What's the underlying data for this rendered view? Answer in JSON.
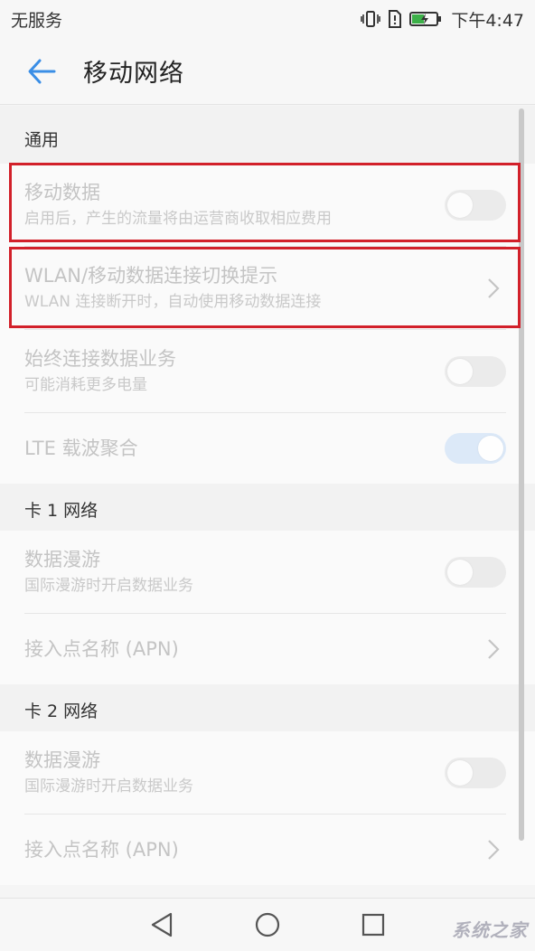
{
  "status_bar": {
    "carrier": "无服务",
    "time": "下午4:47",
    "battery_level": 0.5
  },
  "header": {
    "title": "移动网络"
  },
  "sections": {
    "general": {
      "label": "通用",
      "items": [
        {
          "title": "移动数据",
          "subtitle": "启用后，产生的流量将由运营商收取相应费用",
          "control": "toggle",
          "on": false
        },
        {
          "title": "WLAN/移动数据连接切换提示",
          "subtitle": "WLAN 连接断开时，自动使用移动数据连接",
          "control": "chevron"
        },
        {
          "title": "始终连接数据业务",
          "subtitle": "可能消耗更多电量",
          "control": "toggle",
          "on": false
        },
        {
          "title": "LTE 载波聚合",
          "control": "toggle",
          "on": true
        }
      ]
    },
    "sim1": {
      "label": "卡 1 网络",
      "items": [
        {
          "title": "数据漫游",
          "subtitle": "国际漫游时开启数据业务",
          "control": "toggle",
          "on": false
        },
        {
          "title": "接入点名称 (APN)",
          "control": "chevron"
        }
      ]
    },
    "sim2": {
      "label": "卡 2 网络",
      "items": [
        {
          "title": "数据漫游",
          "subtitle": "国际漫游时开启数据业务",
          "control": "toggle",
          "on": false
        },
        {
          "title": "接入点名称 (APN)",
          "control": "chevron"
        }
      ]
    }
  },
  "watermark": "系统之家",
  "colors": {
    "accent": "#3a8ee6",
    "highlight": "#d2202a",
    "battery": "#3cb048"
  }
}
